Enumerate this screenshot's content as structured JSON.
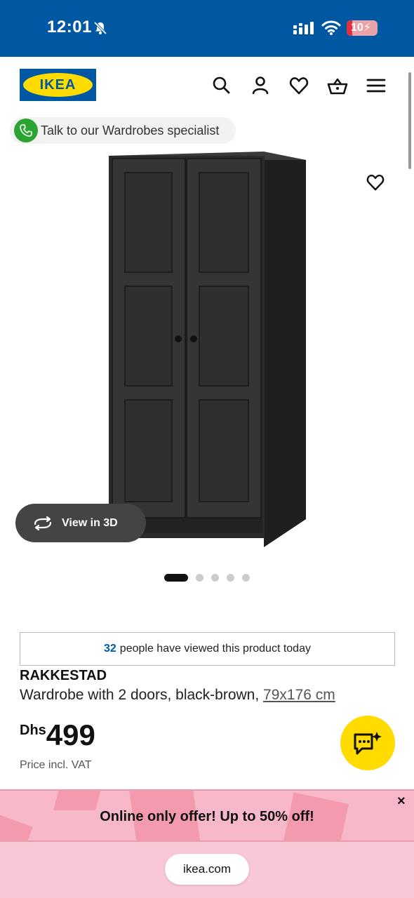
{
  "status_bar": {
    "time": "12:01",
    "battery": "10"
  },
  "header": {
    "logo_text": "IKEA"
  },
  "talk_button": {
    "label": "Talk to our Wardrobes specialist"
  },
  "gallery": {
    "view_3d_label": "View in 3D",
    "image_count": 5,
    "active_index": 0
  },
  "viewed_banner": {
    "count": "32",
    "text": "people have viewed this product today"
  },
  "product": {
    "name": "RAKKESTAD",
    "description": "Wardrobe with 2 doors, black-brown,",
    "size_link": "79x176 cm",
    "currency": "Dhs",
    "price": "499",
    "vat_note": "Price incl. VAT"
  },
  "promo": {
    "text": "Online only offer! Up to 50% off!",
    "close_label": "×"
  },
  "browser": {
    "url": "ikea.com"
  },
  "colors": {
    "ikea_blue": "#0058a3",
    "ikea_yellow": "#ffdb00",
    "promo_pink": "#f7b9c9",
    "call_green": "#2ca431"
  }
}
